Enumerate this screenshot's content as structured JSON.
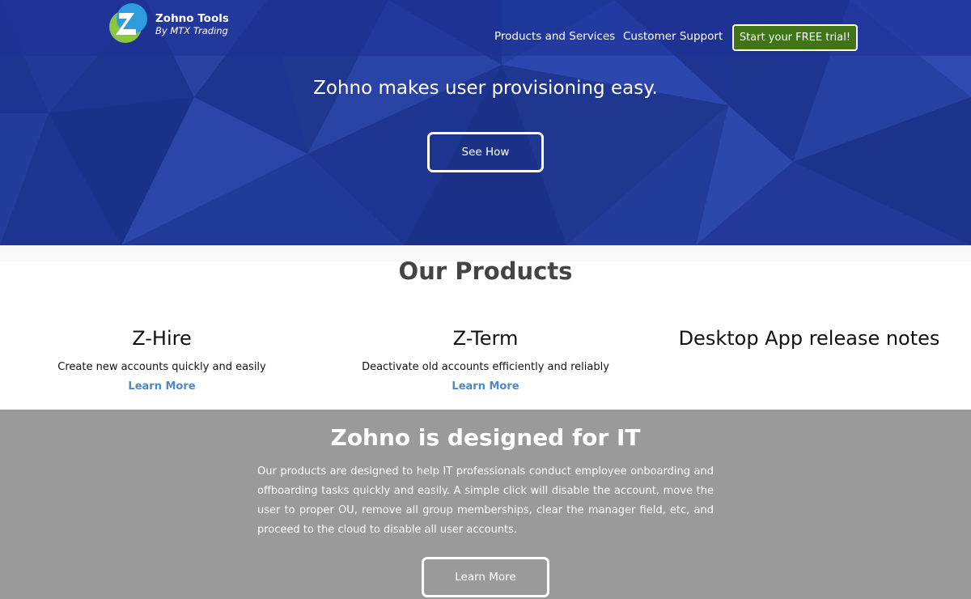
{
  "header": {
    "logo_title": "Zohno Tools",
    "logo_subtitle": "By MTX Trading",
    "nav": {
      "products": "Products and Services",
      "support": "Customer Support"
    },
    "trial_button": "Start your FREE trial!"
  },
  "hero": {
    "tagline": "Zohno makes user provisioning easy.",
    "cta": "See How"
  },
  "products": {
    "title": "Our Products",
    "items": [
      {
        "name": "Z-Hire",
        "description": "Create new accounts quickly and easily",
        "link": "Learn More"
      },
      {
        "name": "Z-Term",
        "description": "Deactivate old accounts efficiently and reliably",
        "link": "Learn More"
      },
      {
        "name": "Desktop App release notes"
      }
    ]
  },
  "it_section": {
    "title": "Zohno is designed for IT",
    "body": "Our products are designed to help IT professionals conduct employee onboarding and offboarding tasks quickly and easily. A simple click will disable the account, move the user to proper OU, remove all group memberships, clear the manager field, etc, and proceed to the cloud to disable all user accounts.",
    "cta": "Learn More"
  },
  "colors": {
    "hero_bg": "#1d3590",
    "trial_green": "#3f7417",
    "link_blue": "#4f87c8",
    "it_gray": "#9a9a9a"
  },
  "icons": {
    "logo": "zohno-z-logo-icon"
  }
}
